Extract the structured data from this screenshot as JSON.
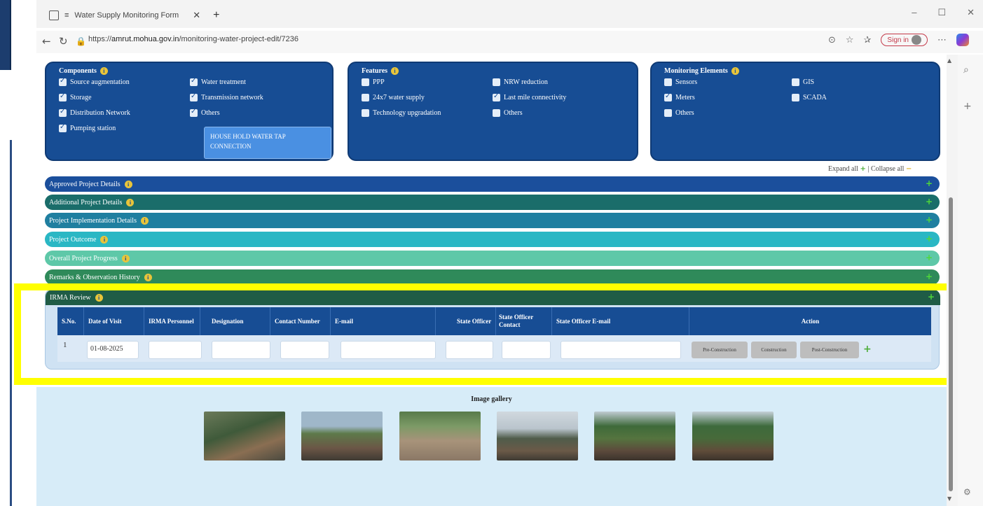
{
  "browser": {
    "tab_title": "Water Supply Monitoring Form",
    "url_prefix": "https://",
    "url_domain": "amrut.mohua.gov.in",
    "url_path": "/monitoring-water-project-edit/7236",
    "signin_label": "Sign in"
  },
  "components": {
    "title": "Components",
    "items": [
      {
        "label": "Source augmentation",
        "checked": true
      },
      {
        "label": "Water treatment",
        "checked": true
      },
      {
        "label": "Storage",
        "checked": true
      },
      {
        "label": "Transmission network",
        "checked": true
      },
      {
        "label": "Distribution Network",
        "checked": true
      },
      {
        "label": "Others",
        "checked": true
      },
      {
        "label": "Pumping station",
        "checked": true
      }
    ],
    "others_value": "HOUSE HOLD WATER TAP CONNECTION"
  },
  "features": {
    "title": "Features",
    "items": [
      {
        "label": "PPP",
        "checked": false
      },
      {
        "label": "NRW reduction",
        "checked": false
      },
      {
        "label": "24x7 water supply",
        "checked": false
      },
      {
        "label": "Last mile connectivity",
        "checked": true
      },
      {
        "label": "Technology upgradation",
        "checked": false
      },
      {
        "label": "Others",
        "checked": false
      }
    ]
  },
  "monitoring": {
    "title": "Monitoring Elements",
    "items": [
      {
        "label": "Sensors",
        "checked": false
      },
      {
        "label": "GIS",
        "checked": false
      },
      {
        "label": "Meters",
        "checked": true
      },
      {
        "label": "SCADA",
        "checked": false
      },
      {
        "label": "Others",
        "checked": false
      }
    ]
  },
  "expand_collapse": {
    "expand": "Expand all",
    "collapse": "Collapse all"
  },
  "sections": [
    {
      "label": "Approved Project Details",
      "color": "#1b4f9c"
    },
    {
      "label": "Additional Project Details",
      "color": "#1a6d6a"
    },
    {
      "label": "Project Implementation Details",
      "color": "#1f7fa0"
    },
    {
      "label": "Project Outcome",
      "color": "#2ab7c4"
    },
    {
      "label": "Overall Project Progress",
      "color": "#5ec8a8"
    },
    {
      "label": "Remarks & Observation History",
      "color": "#2f8a5a"
    }
  ],
  "irma": {
    "title": "IRMA Review",
    "headers": [
      "S.No.",
      "Date of Visit",
      "IRMA Personnel",
      "Designation",
      "Contact Number",
      "E-mail",
      "State Officer",
      "State Officer Contact",
      "State Officer E-mail",
      "Action"
    ],
    "rows": [
      {
        "sno": "1",
        "date": "01-08-2025",
        "personnel": "",
        "designation": "",
        "contact": "",
        "email": "",
        "state_officer": "",
        "so_contact": "",
        "so_email": ""
      }
    ],
    "actions": [
      "Pre-Construction",
      "Construction",
      "Post-Construction"
    ]
  },
  "gallery": {
    "title": "Image gallery",
    "images": [
      {
        "name": "site-photo-1"
      },
      {
        "name": "site-photo-2"
      },
      {
        "name": "site-photo-3"
      },
      {
        "name": "site-photo-4"
      },
      {
        "name": "site-photo-5"
      },
      {
        "name": "site-photo-6"
      }
    ]
  }
}
